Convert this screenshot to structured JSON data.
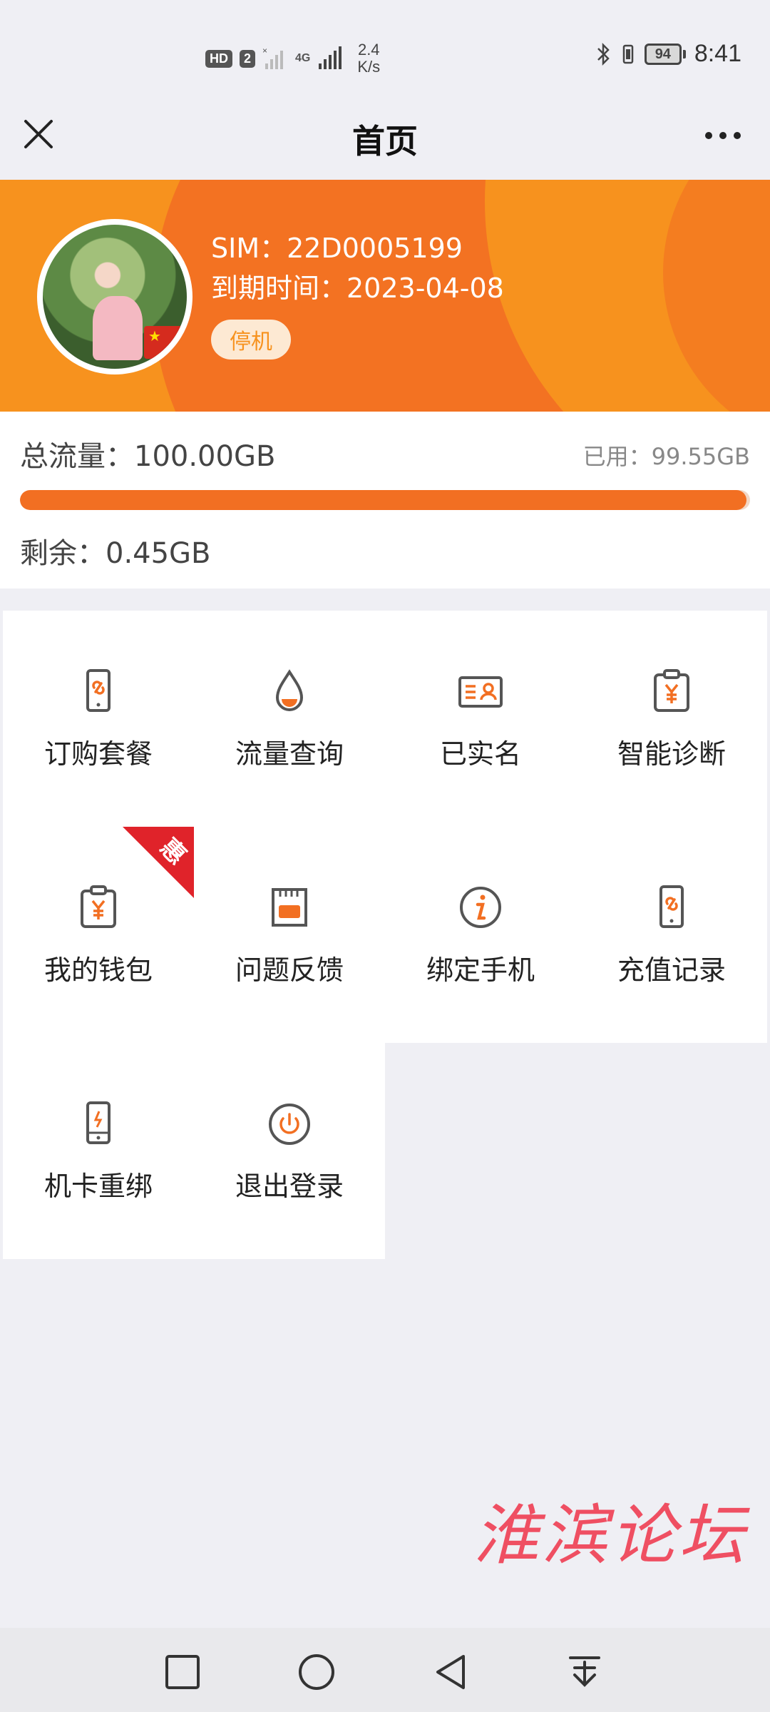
{
  "status_bar": {
    "hd_label": "HD",
    "sim_label": "2",
    "network_label": "4G",
    "speed_value": "2.4",
    "speed_unit": "K/s",
    "battery": "94",
    "time": "8:41"
  },
  "nav": {
    "title": "首页"
  },
  "profile": {
    "sim_line": "SIM：22D0005199",
    "expiry_line": "到期时间：2023-04-08",
    "status": "停机"
  },
  "usage": {
    "total": "总流量：100.00GB",
    "used": "已用：99.55GB",
    "remaining": "剩余：0.45GB",
    "used_fraction": 0.9955
  },
  "menu": {
    "items": [
      {
        "label": "订购套餐",
        "icon": "phone-link-icon"
      },
      {
        "label": "流量查询",
        "icon": "drop-icon"
      },
      {
        "label": "已实名",
        "icon": "id-card-icon"
      },
      {
        "label": "智能诊断",
        "icon": "clipboard-yuan-icon"
      },
      {
        "label": "我的钱包",
        "icon": "clipboard-yuan-icon",
        "badge": "惠"
      },
      {
        "label": "问题反馈",
        "icon": "sim-card-icon"
      },
      {
        "label": "绑定手机",
        "icon": "info-icon"
      },
      {
        "label": "充值记录",
        "icon": "phone-link-icon"
      },
      {
        "label": "机卡重绑",
        "icon": "phone-rebind-icon"
      },
      {
        "label": "退出登录",
        "icon": "power-icon"
      }
    ]
  },
  "watermark": "淮滨论坛",
  "colors": {
    "accent": "#f26f22",
    "header_orange": "#f7921e",
    "badge_red": "#e0232a",
    "icon_dark": "#555555"
  }
}
